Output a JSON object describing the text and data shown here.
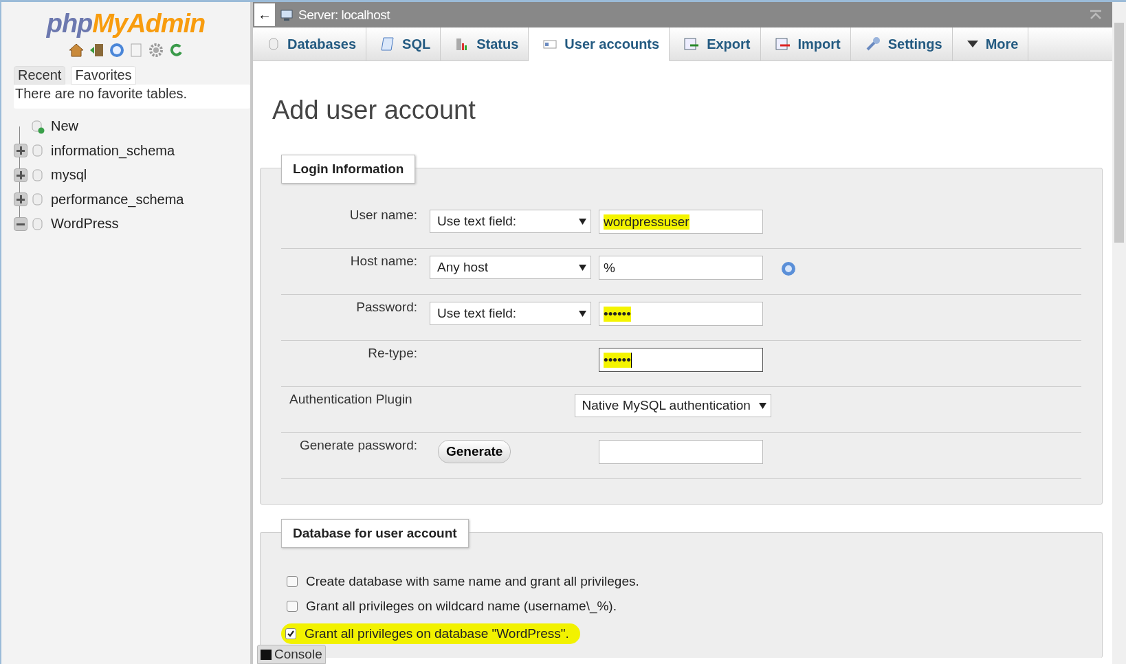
{
  "sidebar": {
    "logo": {
      "part_1": "php",
      "part_2": "MyAdmin"
    },
    "tabs": [
      {
        "label": "Recent",
        "selected": false
      },
      {
        "label": "Favorites",
        "selected": true
      }
    ],
    "favorites_message": "There are no favorite tables.",
    "tree": [
      {
        "label": "New",
        "kind": "new"
      },
      {
        "label": "information_schema",
        "kind": "database",
        "expanded": false
      },
      {
        "label": "mysql",
        "kind": "database",
        "expanded": false
      },
      {
        "label": "performance_schema",
        "kind": "database",
        "expanded": false
      },
      {
        "label": "WordPress",
        "kind": "database",
        "expanded": true
      }
    ]
  },
  "topbar": {
    "back": "←",
    "title": "Server: localhost"
  },
  "tabs": [
    {
      "label": "Databases",
      "selected": false
    },
    {
      "label": "SQL",
      "selected": false
    },
    {
      "label": "Status",
      "selected": false
    },
    {
      "label": "User accounts",
      "selected": true
    },
    {
      "label": "Export",
      "selected": false
    },
    {
      "label": "Import",
      "selected": false
    },
    {
      "label": "Settings",
      "selected": false
    },
    {
      "label": "More",
      "selected": false
    }
  ],
  "heading": "Add user account",
  "login": {
    "legend": "Login Information",
    "rows": [
      {
        "kind": "field",
        "label": "User name:",
        "select": "Use text field:",
        "value": "wordpressuser",
        "highlighted": true,
        "focused": false
      },
      {
        "kind": "field",
        "label": "Host name:",
        "select": "Any host",
        "value": "%",
        "highlighted": false,
        "focused": false,
        "help": true
      },
      {
        "kind": "field",
        "label": "Password:",
        "select": "Use text field:",
        "value": "••••••",
        "highlighted": true,
        "focused": false
      },
      {
        "kind": "field",
        "label": "Re-type:",
        "value": "••••••",
        "highlighted": true,
        "focused": true
      },
      {
        "kind": "plugin",
        "label": "Authentication Plugin",
        "select": "Native MySQL authentication"
      },
      {
        "kind": "generate",
        "label": "Generate password:",
        "button": "Generate"
      }
    ]
  },
  "database": {
    "legend": "Database for user account",
    "options": [
      {
        "label": "Create database with same name and grant all privileges.",
        "checked": false,
        "highlighted": false
      },
      {
        "label": "Grant all privileges on wildcard name (username\\_%).",
        "checked": false,
        "highlighted": false
      },
      {
        "label": "Grant all privileges on database \"WordPress\".",
        "checked": true,
        "highlighted": true
      }
    ]
  },
  "console": "Console"
}
